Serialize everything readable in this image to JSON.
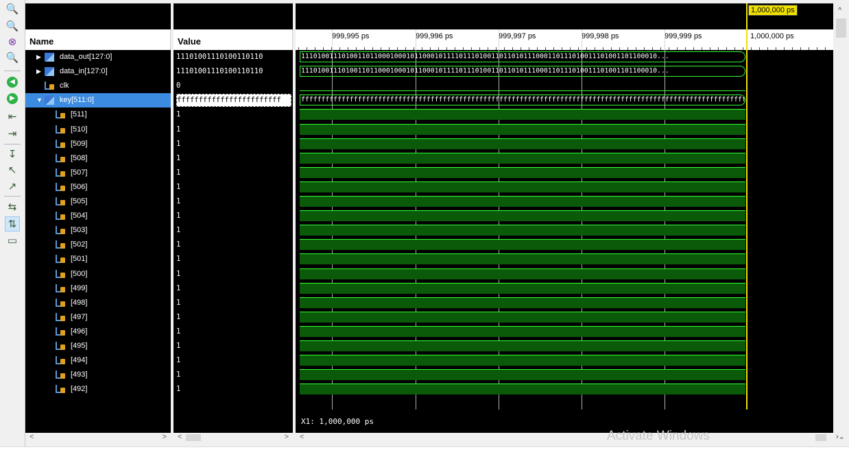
{
  "toolbar": {
    "icons": [
      "zoom-in-icon",
      "zoom-out-icon",
      "zoom-fit-icon",
      "zoom-full-icon",
      "go-start-icon",
      "go-end-icon",
      "prev-transition-icon",
      "next-transition-icon",
      "add-marker-icon",
      "prev-marker-icon",
      "next-marker-icon",
      "swap-cursors-icon",
      "snap-transition-icon",
      "float-ruler-icon"
    ]
  },
  "columns": {
    "name": "Name",
    "value": "Value"
  },
  "signals": [
    {
      "name": "data_out[127:0]",
      "value": "11101001110100110110",
      "type": "bus",
      "expandable": true
    },
    {
      "name": "data_in[127:0]",
      "value": "11101001110100110110",
      "type": "bus",
      "expandable": true
    },
    {
      "name": "clk",
      "value": "0",
      "type": "bit"
    },
    {
      "name": "key[511:0]",
      "value": "ffffffffffffffffffffffff",
      "type": "bus",
      "expanded": true,
      "selected": true
    },
    {
      "name": "[511]",
      "value": "1",
      "type": "bit"
    },
    {
      "name": "[510]",
      "value": "1",
      "type": "bit"
    },
    {
      "name": "[509]",
      "value": "1",
      "type": "bit"
    },
    {
      "name": "[508]",
      "value": "1",
      "type": "bit"
    },
    {
      "name": "[507]",
      "value": "1",
      "type": "bit"
    },
    {
      "name": "[506]",
      "value": "1",
      "type": "bit"
    },
    {
      "name": "[505]",
      "value": "1",
      "type": "bit"
    },
    {
      "name": "[504]",
      "value": "1",
      "type": "bit"
    },
    {
      "name": "[503]",
      "value": "1",
      "type": "bit"
    },
    {
      "name": "[502]",
      "value": "1",
      "type": "bit"
    },
    {
      "name": "[501]",
      "value": "1",
      "type": "bit"
    },
    {
      "name": "[500]",
      "value": "1",
      "type": "bit"
    },
    {
      "name": "[499]",
      "value": "1",
      "type": "bit"
    },
    {
      "name": "[498]",
      "value": "1",
      "type": "bit"
    },
    {
      "name": "[497]",
      "value": "1",
      "type": "bit"
    },
    {
      "name": "[496]",
      "value": "1",
      "type": "bit"
    },
    {
      "name": "[495]",
      "value": "1",
      "type": "bit"
    },
    {
      "name": "[494]",
      "value": "1",
      "type": "bit"
    },
    {
      "name": "[493]",
      "value": "1",
      "type": "bit"
    },
    {
      "name": "[492]",
      "value": "1",
      "type": "bit"
    }
  ],
  "waveform": {
    "bus_text": {
      "data_out": "1110100111010011011000100010110001011110111010011011010111000110111010011101001101100010...",
      "data_in": "1110100111010011011000100010110001011110111010011011010111000110111010011101001101100010...",
      "key": "fffffffffffffffffffffffffffffffffffffffffffffffffffffffffffffffffffffffffffffffffffffffffffffffffffffffffffffff"
    },
    "time_ticks": [
      "999,995 ps",
      "999,996 ps",
      "999,997 ps",
      "999,998 ps",
      "999,999 ps",
      "1,000,000 ps"
    ],
    "cursor_label": "1,000,000 ps",
    "x1_readout": "X1: 1,000,000 ps",
    "signal_color": "#33ff33",
    "fill_color": "#0a5a0a",
    "cursor_color": "#f0e000"
  },
  "watermark": "Activate Windows"
}
